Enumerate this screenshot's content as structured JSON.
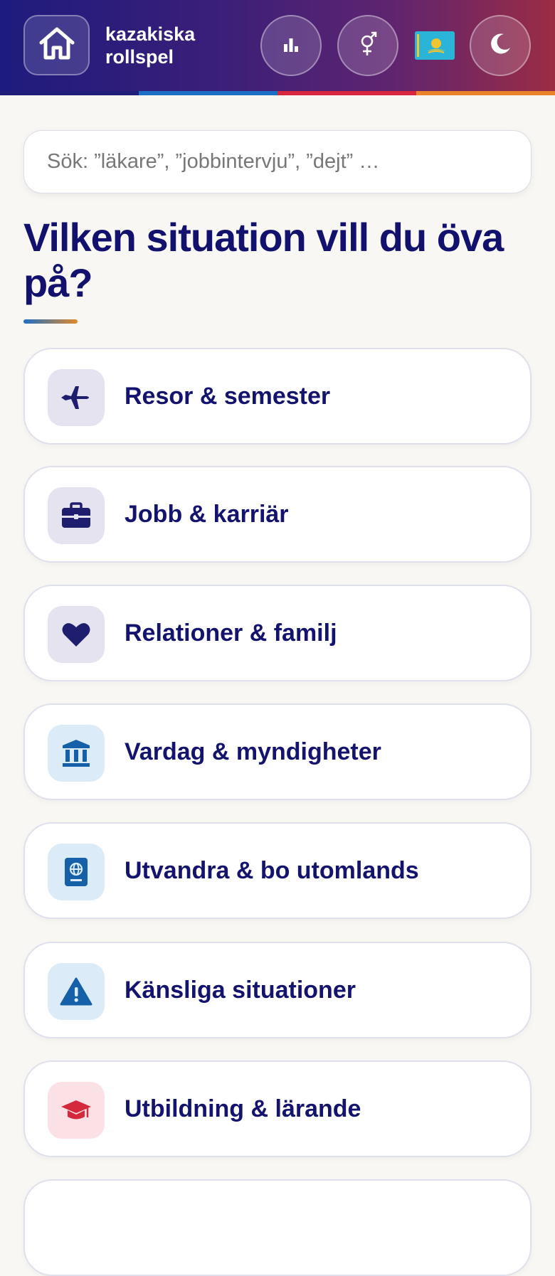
{
  "header": {
    "app_name_line1": "kazakiska",
    "app_name_line2": "rollspel",
    "stripe_colors": [
      "#1f1d7a",
      "#1d6fc4",
      "#d9263f",
      "#e8832a"
    ]
  },
  "search": {
    "placeholder": "Sök: ”läkare”, ”jobbintervju”, ”dejt” …"
  },
  "heading": "Vilken situation vill du öva på?",
  "categories": [
    {
      "label": "Resor & semester",
      "icon": "airplane-icon",
      "icon_bg": "#e4e3ef",
      "icon_color": "#1f1d6e"
    },
    {
      "label": "Jobb & karriär",
      "icon": "briefcase-icon",
      "icon_bg": "#e4e3ef",
      "icon_color": "#1f1d6e"
    },
    {
      "label": "Relationer & familj",
      "icon": "heart-icon",
      "icon_bg": "#e4e3ef",
      "icon_color": "#1f1d6e"
    },
    {
      "label": "Vardag & myndigheter",
      "icon": "building-icon",
      "icon_bg": "#dcebf8",
      "icon_color": "#1560a8"
    },
    {
      "label": "Utvandra & bo utomlands",
      "icon": "passport-icon",
      "icon_bg": "#dcebf8",
      "icon_color": "#1560a8"
    },
    {
      "label": "Känsliga situationer",
      "icon": "warning-icon",
      "icon_bg": "#dcebf8",
      "icon_color": "#1560a8"
    },
    {
      "label": "Utbildning & lärande",
      "icon": "graduation-cap-icon",
      "icon_bg": "#fbe1e6",
      "icon_color": "#d4283d"
    }
  ]
}
